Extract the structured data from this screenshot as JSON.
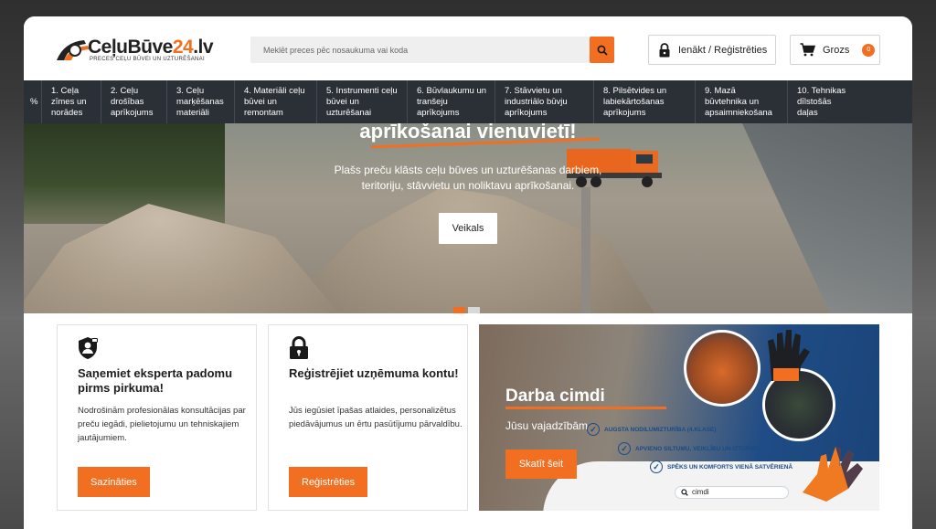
{
  "header": {
    "logo_brand_main": "CeļuBūve",
    "logo_brand_num": "24",
    "logo_brand_tld": ".lv",
    "logo_tagline": "PRECES CEĻU BŪVEI UN UZTURĒŠANAI",
    "search_placeholder": "Meklēt preces pēc nosaukuma vai koda",
    "login_label": "Ienākt / Reģistrēties",
    "cart_label": "Grozs",
    "cart_count": "0"
  },
  "nav": {
    "items": [
      {
        "lines": [
          "%"
        ]
      },
      {
        "lines": [
          "1. Ceļa",
          "zīmes un",
          "norādes"
        ]
      },
      {
        "lines": [
          "2. Ceļu",
          "drošības",
          "aprīkojums"
        ]
      },
      {
        "lines": [
          "3. Ceļu",
          "marķēšanas",
          "materiāli"
        ]
      },
      {
        "lines": [
          "4. Materiāli ceļu",
          "būvei un",
          "remontam"
        ]
      },
      {
        "lines": [
          "5. Instrumenti ceļu",
          "būvei un",
          "uzturēšanai"
        ]
      },
      {
        "lines": [
          "6. Būvlaukumu un",
          "tranšeju",
          "aprīkojums"
        ]
      },
      {
        "lines": [
          "7. Stāvvietu un",
          "industriālo būvju",
          "aprīkojums"
        ]
      },
      {
        "lines": [
          "8. Pilsētvides un",
          "labiekārtošanas",
          "aprīkojums"
        ]
      },
      {
        "lines": [
          "9. Mazā",
          "būvtehnika un",
          "apsaimniekošana"
        ]
      },
      {
        "lines": [
          "10. Tehnikas",
          "dīlstošās",
          "daļas"
        ]
      }
    ]
  },
  "hero": {
    "title": "aprīkošanai vienuvietī!",
    "subtitle_line1": "Plašs preču klāsts ceļu būves un uzturēšanas darbiem,",
    "subtitle_line2": "teritoriju, stāvvietu un noliktavu aprīkošanai.",
    "button_label": "Veikals",
    "slides": 2,
    "active_slide": 1
  },
  "cards": [
    {
      "title": "Saņemiet eksperta padomu pirms pirkuma!",
      "text": "Nodrošinām profesionālas konsultācijas par preču iegādi, pielietojumu un tehniskajiem jautājumiem.",
      "button_label": "Sazināties",
      "icon": "expert-shield-icon"
    },
    {
      "title": "Reģistrējiet uzņēmuma kontu!",
      "text": "Jūs iegūsiet īpašas atlaides, personalizētus piedāvājumus un ērtu pasūtījumu pārvaldību.",
      "button_label": "Reģistrēties",
      "icon": "lock-icon"
    }
  ],
  "promo": {
    "title": "Darba cimdi",
    "subtitle": "Jūsu vajadzībām",
    "button_label": "Skatīt šeit",
    "features": [
      "AUGSTA NODILUMIZTURĪBA (4.KLASE)",
      "APVIENO SILTUMU, VEIKLĪBU UN IZTURĪBU",
      "SPĒKS UN KOMFORTS VIENĀ SATVĒRIENĀ"
    ],
    "search_text": "cimdi"
  },
  "colors": {
    "accent": "#f26f21",
    "nav_bg": "#2b2f36",
    "promo_blue": "#1b4b85"
  }
}
